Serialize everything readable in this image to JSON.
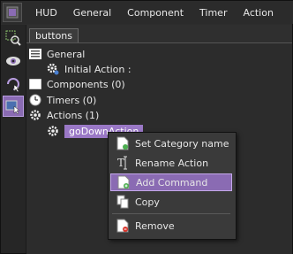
{
  "menubar": {
    "items": [
      "HUD",
      "General",
      "Component",
      "Timer",
      "Action"
    ]
  },
  "panel": {
    "tab_label": "buttons"
  },
  "tree": {
    "general": "General",
    "initial_action": "Initial Action :",
    "components": "Components (0)",
    "timers": "Timers (0)",
    "actions": "Actions (1)",
    "action_item": "goDownAction"
  },
  "context_menu": {
    "items": [
      "Set Category name",
      "Rename Action",
      "Add Command",
      "Copy",
      "Remove"
    ],
    "highlighted": "Add Command"
  },
  "colors": {
    "accent": "#8a6bb3",
    "selection": "#9a78c6",
    "background": "#2c2c2c"
  }
}
